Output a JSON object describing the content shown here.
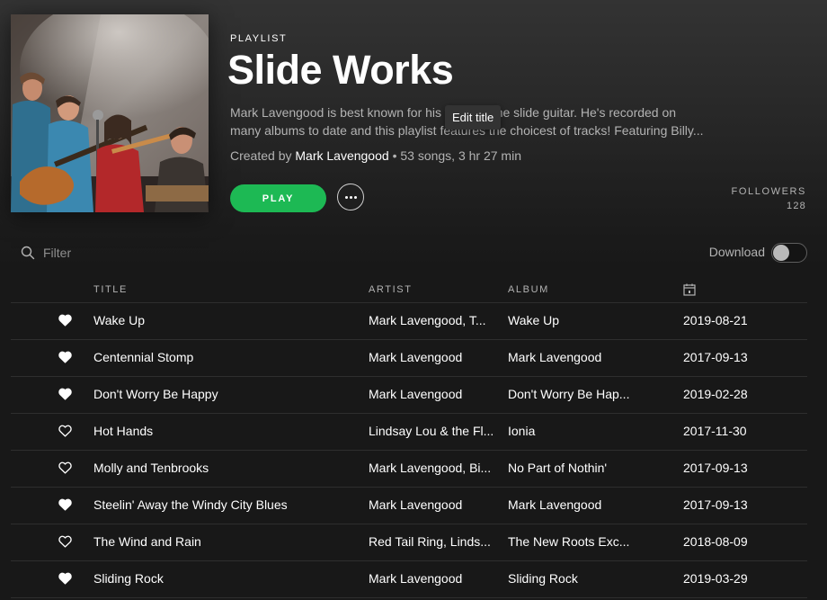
{
  "header": {
    "type_label": "PLAYLIST",
    "title": "Slide Works",
    "description_line1": "Mark Lavengood is best known for his work on the slide guitar. He's recorded on",
    "description_line2": "many albums to date and this playlist features the choicest of tracks! Featuring Billy...",
    "tooltip": "Edit title",
    "created_by_label": "Created by",
    "owner": "Mark Lavengood",
    "stats": "• 53 songs, 3 hr 27 min",
    "play_label": "PLAY",
    "followers_label": "FOLLOWERS",
    "followers_count": "128"
  },
  "toolbar": {
    "filter_placeholder": "Filter",
    "download_label": "Download",
    "download_enabled": false
  },
  "table": {
    "columns": {
      "title": "TITLE",
      "artist": "ARTIST",
      "album": "ALBUM",
      "date_icon": "calendar-icon"
    },
    "rows": [
      {
        "liked": true,
        "title": "Wake Up",
        "artist": "Mark Lavengood, T...",
        "album": "Wake Up",
        "date": "2019-08-21"
      },
      {
        "liked": true,
        "title": "Centennial Stomp",
        "artist": "Mark Lavengood",
        "album": "Mark Lavengood",
        "date": "2017-09-13"
      },
      {
        "liked": true,
        "title": "Don't Worry Be Happy",
        "artist": "Mark Lavengood",
        "album": "Don't Worry Be Hap...",
        "date": "2019-02-28"
      },
      {
        "liked": false,
        "title": "Hot Hands",
        "artist": "Lindsay Lou & the Fl...",
        "album": "Ionia",
        "date": "2017-11-30"
      },
      {
        "liked": false,
        "title": "Molly and Tenbrooks",
        "artist": "Mark Lavengood, Bi...",
        "album": "No Part of Nothin'",
        "date": "2017-09-13"
      },
      {
        "liked": true,
        "title": "Steelin' Away the Windy City Blues",
        "artist": "Mark Lavengood",
        "album": "Mark Lavengood",
        "date": "2017-09-13"
      },
      {
        "liked": false,
        "title": "The Wind and Rain",
        "artist": "Red Tail Ring, Linds...",
        "album": "The New Roots Exc...",
        "date": "2018-08-09"
      },
      {
        "liked": true,
        "title": "Sliding Rock",
        "artist": "Mark Lavengood",
        "album": "Sliding Rock",
        "date": "2019-03-29"
      }
    ]
  },
  "colors": {
    "accent": "#1db954",
    "background": "#181818",
    "text_muted": "#b3b3b3"
  }
}
